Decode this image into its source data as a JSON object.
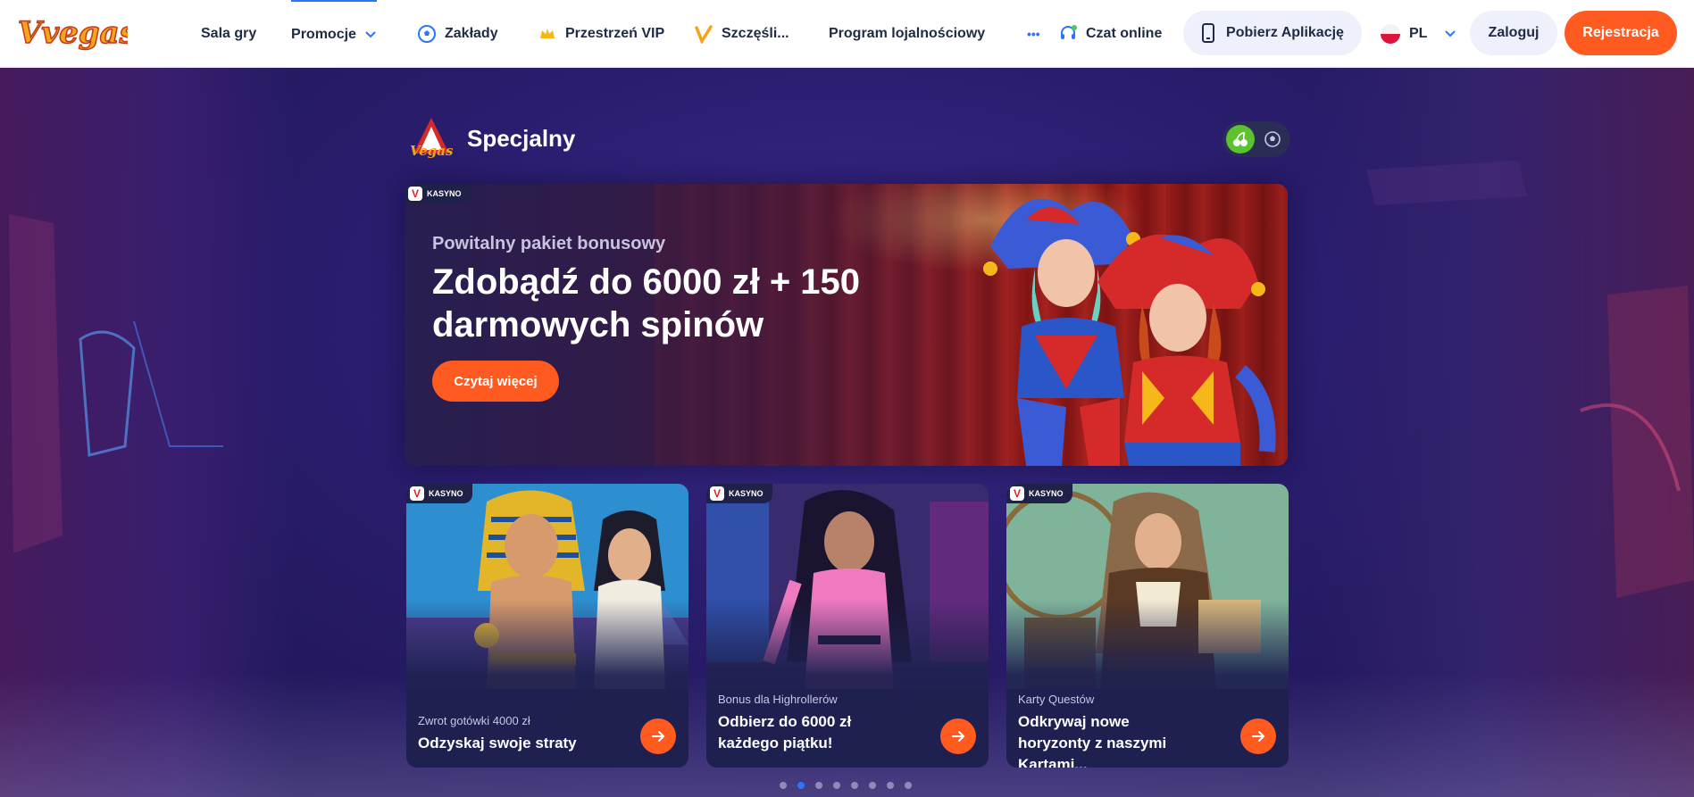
{
  "header": {
    "logo_text": "Vvegas",
    "nav": [
      {
        "label": "Sala gry"
      },
      {
        "label": "Promocje"
      },
      {
        "label": "Zakłady"
      },
      {
        "label": "Przestrzeń VIP"
      },
      {
        "label": "Szczęśli..."
      },
      {
        "label": "Program lojalnościowy"
      }
    ],
    "more_label": "•••",
    "chat_label": "Czat online",
    "app_label": "Pobierz Aplikację",
    "lang_label": "PL",
    "login_label": "Zaloguj",
    "register_label": "Rejestracja"
  },
  "section": {
    "logo_text": "Vegas",
    "title": "Specjalny"
  },
  "hero": {
    "badge": "KASYNO",
    "subtitle": "Powitalny pakiet bonusowy",
    "title": "Zdobądź do 6000 zł + 150 darmowych spinów",
    "button": "Czytaj więcej"
  },
  "cards": [
    {
      "badge": "KASYNO",
      "subtitle": "Zwrot gotówki 4000 zł",
      "title": "Odzyskaj swoje straty"
    },
    {
      "badge": "KASYNO",
      "subtitle": "Bonus dla Highrollerów",
      "title": "Odbierz do 6000 zł każdego piątku!"
    },
    {
      "badge": "KASYNO",
      "subtitle": "Karty Questów",
      "title": "Odkrywaj nowe horyzonty z naszymi Kartami..."
    }
  ],
  "pagination": {
    "count": 8,
    "active_index": 1
  },
  "colors": {
    "accent": "#ff5a1f",
    "active_blue": "#2c74ff",
    "toggle_green": "#5cc230"
  }
}
